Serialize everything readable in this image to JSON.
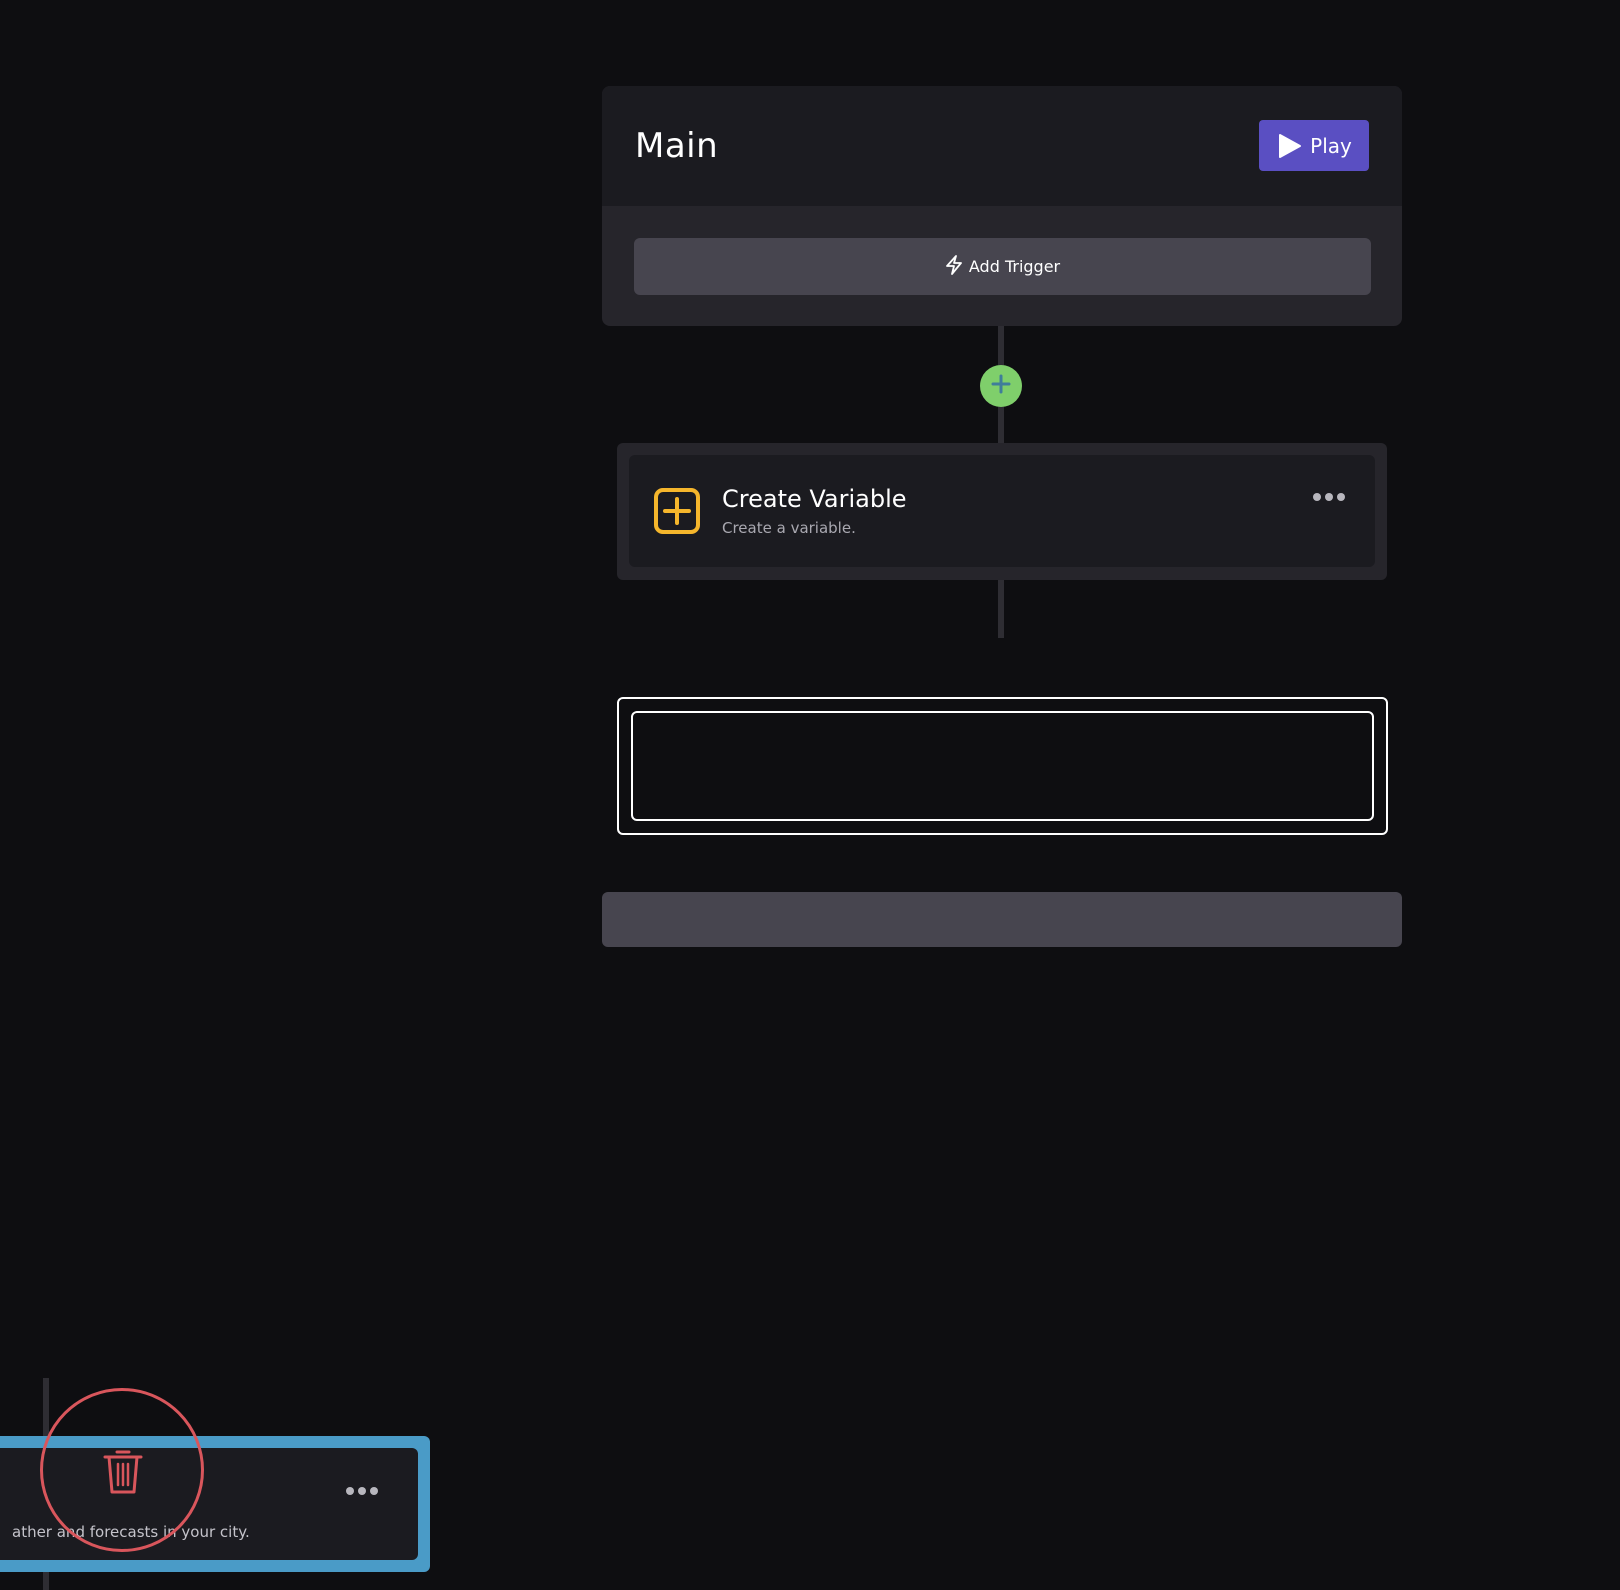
{
  "main": {
    "title": "Main",
    "play_label": "Play",
    "add_trigger_label": "Add Trigger"
  },
  "step": {
    "title": "Create Variable",
    "subtitle": "Create a variable."
  },
  "dragged_step": {
    "description": "ather and forecasts in your city."
  },
  "icons": {
    "play": "play-icon",
    "trigger": "lightning-icon",
    "add_step": "plus-icon",
    "variable": "plus-square-icon",
    "menu": "more-horizontal-icon",
    "delete": "trash-icon"
  },
  "colors": {
    "accent": "#5a4fc2",
    "add_step": "#7fcf6b",
    "variable_icon": "#f5b62c",
    "drag_highlight": "#4a9bc7",
    "delete": "#d9565c"
  }
}
